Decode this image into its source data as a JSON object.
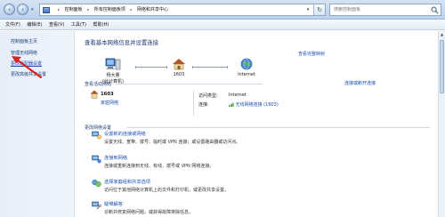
{
  "address": {
    "crumbs": [
      "控制面板",
      "所有控制面板项",
      "网络和共享中心"
    ],
    "search_placeholder": "搜索控制面板"
  },
  "menu": [
    "文件(F)",
    "编辑(E)",
    "查看(V)",
    "工具(T)",
    "帮助(H)"
  ],
  "sidebar": {
    "home": "控制面板主页",
    "items": [
      "管理无线网络",
      "更改适配器设置",
      "更改高级共享设置"
    ]
  },
  "main": {
    "title": "查看基本网络信息并设置连接",
    "full_map": "查看完整映射",
    "nodes": [
      "杨大量",
      "(此计算机)",
      "1603",
      "Internet"
    ],
    "active_label": "查看活动网络",
    "connect_disconnect": "连接或断开连接",
    "network": {
      "name": "1603",
      "type": "家庭网络",
      "access_label": "访问类型:",
      "access_value": "Internet",
      "conn_label": "连接:",
      "conn_value": "无线网络连接 (1603)"
    },
    "change_label": "更改网络设置",
    "tasks": [
      {
        "title": "设置新的连接或网络",
        "desc": "设置无线、宽带、拨号、临时或 VPN 连接；或设置路由器或访问点。"
      },
      {
        "title": "连接到网络",
        "desc": "连接或重新连接到无线、有线、拨号或 VPN 网络连接。"
      },
      {
        "title": "选择家庭组和共享选项",
        "desc": "访问位于其他网络计算机上的文件和打印机，或更改共享设置。"
      },
      {
        "title": "疑难解答",
        "desc": "诊断并修复网络问题，或获得故障排除信息。"
      }
    ]
  },
  "colors": {
    "link": "#1c4fae",
    "heading": "#1e3d74",
    "annotation_arrow": "#e02020"
  }
}
